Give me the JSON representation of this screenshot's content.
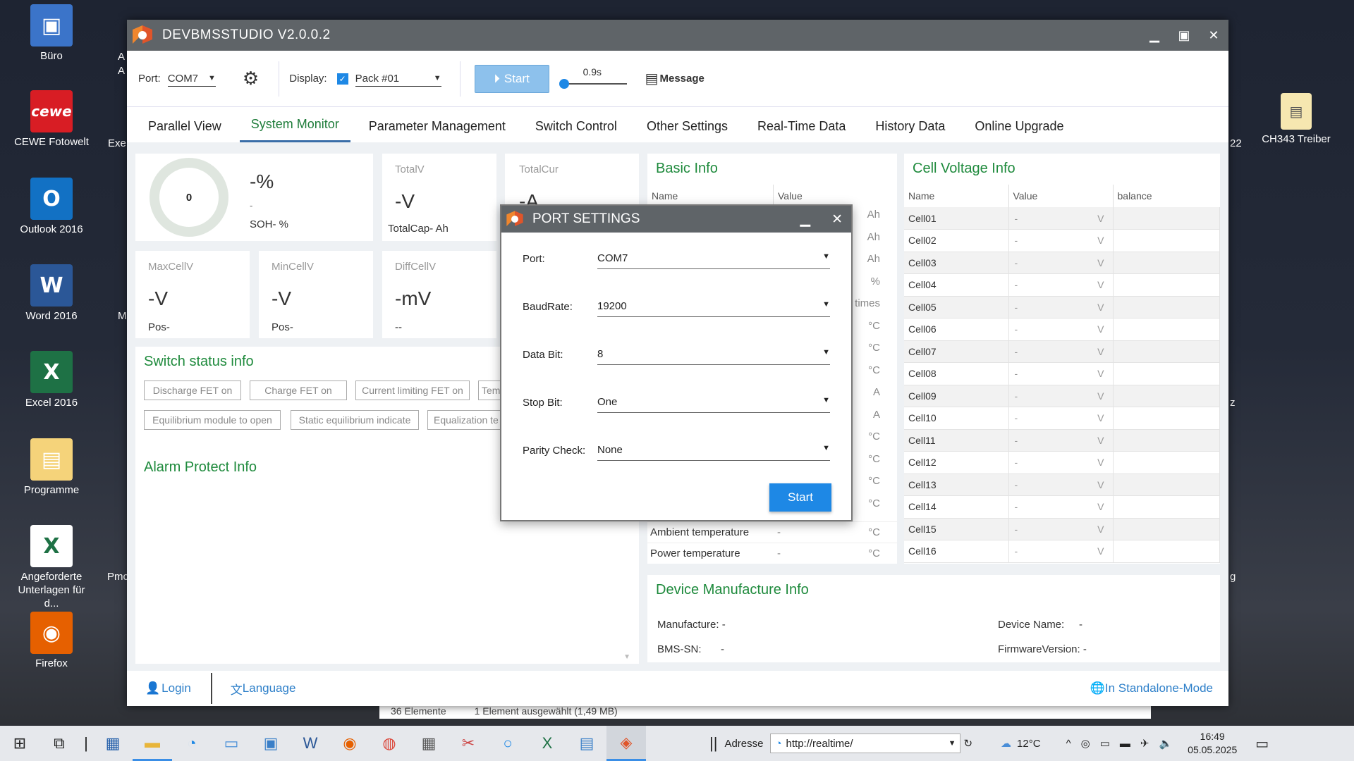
{
  "desktop": {
    "icons": [
      {
        "label": "Büro",
        "color": "#3b74c9",
        "glyph": "▣"
      },
      {
        "label": "CEWE Fotowelt",
        "color": "#d81d24",
        "glyph": "cewe"
      },
      {
        "label": "Outlook 2016",
        "color": "#1271c4",
        "glyph": "O"
      },
      {
        "label": "Word 2016",
        "color": "#2b5797",
        "glyph": "W"
      },
      {
        "label": "Excel 2016",
        "color": "#1e7145",
        "glyph": "X"
      },
      {
        "label": "Programme",
        "color": "#f5d37a",
        "glyph": "▤"
      },
      {
        "label": "Angeforderte Unterlagen für d...",
        "color": "#ffffff",
        "glyph": "X"
      },
      {
        "label": "Firefox",
        "color": "#e66000",
        "glyph": "◉"
      }
    ],
    "right_icon": {
      "label": "CH343 Treiber",
      "glyph": "▤"
    },
    "partial_left": [
      "A",
      "A",
      "Exe",
      "M",
      "Pmc"
    ],
    "partial_right": [
      "22",
      "z",
      "g"
    ],
    "explorer_status": {
      "count": "36 Elemente",
      "selected": "1 Element ausgewählt (1,49 MB)"
    }
  },
  "app": {
    "title": "DEVBMSSTUDIO V2.0.0.2",
    "toolbar": {
      "port_label": "Port:",
      "port_value": "COM7",
      "display_label": "Display:",
      "pack_value": "Pack #01",
      "start_label": "Start",
      "interval": "0.9s",
      "message_label": "Message"
    },
    "tabs": [
      "Parallel View",
      "System Monitor",
      "Parameter Management",
      "Switch Control",
      "Other Settings",
      "Real-Time Data",
      "History Data",
      "Online Upgrade"
    ],
    "gauge": {
      "value": "0",
      "percent": "-%",
      "dash": "-",
      "soh": "SOH- %"
    },
    "totalv": {
      "label": "TotalV",
      "value": "-V",
      "cap": "TotalCap- Ah"
    },
    "totalcur": {
      "label": "TotalCur",
      "value": "-A"
    },
    "maxcell": {
      "label": "MaxCellV",
      "value": "-V",
      "pos": "Pos-"
    },
    "mincell": {
      "label": "MinCellV",
      "value": "-V",
      "pos": "Pos-"
    },
    "diffcell": {
      "label": "DiffCellV",
      "value": "-mV",
      "pos": "--"
    },
    "switch": {
      "title": "Switch status info",
      "buttons": [
        "Discharge FET on",
        "Charge FET on",
        "Current limiting FET on",
        "Tem",
        "Equilibrium module to open",
        "Static equilibrium indicate",
        "Equalization te"
      ]
    },
    "alarm": {
      "title": "Alarm Protect Info"
    },
    "basic": {
      "title": "Basic Info",
      "col_name": "Name",
      "col_value": "Value",
      "units": [
        "Ah",
        "Ah",
        "Ah",
        "%",
        "times",
        "°C",
        "°C",
        "°C",
        "A",
        "A",
        "°C",
        "°C",
        "°C",
        "°C"
      ],
      "rows": [
        {
          "name": "Ambient temperature",
          "value": "-",
          "unit": "°C"
        },
        {
          "name": "Power temperature",
          "value": "-",
          "unit": "°C"
        }
      ]
    },
    "cellv": {
      "title": "Cell Voltage Info",
      "col_name": "Name",
      "col_value": "Value",
      "col_balance": "balance",
      "cells": [
        "Cell01",
        "Cell02",
        "Cell03",
        "Cell04",
        "Cell05",
        "Cell06",
        "Cell07",
        "Cell08",
        "Cell09",
        "Cell10",
        "Cell11",
        "Cell12",
        "Cell13",
        "Cell14",
        "Cell15",
        "Cell16"
      ],
      "value": "-",
      "unit": "V"
    },
    "device": {
      "title": "Device Manufacture Info",
      "manufacture": "Manufacture: -",
      "bmssn": "BMS-SN:",
      "bmssn_val": "-",
      "devname": "Device Name:",
      "devname_val": "-",
      "firmware": "FirmwareVersion: -"
    },
    "status": {
      "login": "Login",
      "language": "Language",
      "mode": "In Standalone-Mode"
    }
  },
  "dialog": {
    "title": "PORT SETTINGS",
    "fields": [
      {
        "label": "Port:",
        "value": "COM7"
      },
      {
        "label": "BaudRate:",
        "value": "19200"
      },
      {
        "label": "Data Bit:",
        "value": "8"
      },
      {
        "label": "Stop Bit:",
        "value": "One"
      },
      {
        "label": "Parity Check:",
        "value": "None"
      }
    ],
    "start": "Start"
  },
  "taskbar": {
    "address_label": "Adresse",
    "address_value": "http://realtime/",
    "temp": "12°C",
    "time": "16:49",
    "date": "05.05.2025"
  },
  "colors": {
    "accent_green": "#1e8a3c",
    "titlebar": "#5f6468",
    "button_blue": "#1e88e5"
  }
}
